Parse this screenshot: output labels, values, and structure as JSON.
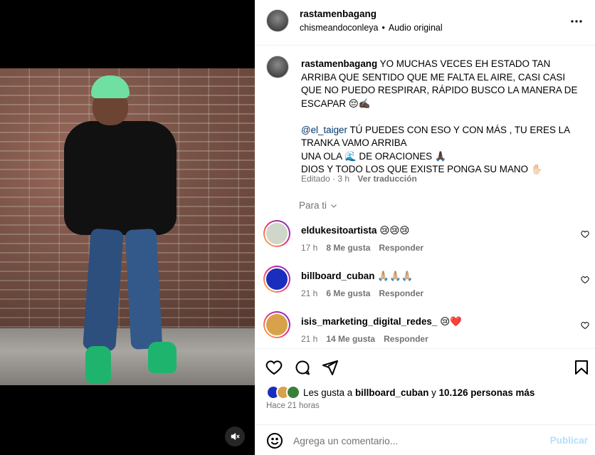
{
  "post": {
    "username": "rastamenbagang",
    "audio_user": "chismeandoconleya",
    "audio_sep": "•",
    "audio_label": "Audio original"
  },
  "caption": {
    "username": "rastamenbagang",
    "line1": "YO MUCHAS VECES EH ESTADO TAN ARRIBA QUE SENTIDO QUE ME FALTA EL AIRE, CASI CASI QUE NO PUEDO RESPIRAR, RÁPIDO BUSCO LA MANERA DE ESCAPAR 😔✍🏿",
    "mention": "@el_taiger",
    "line2": "TÚ PUEDES CON ESO Y CON MÁS , TU ERES LA TRANKA VAMO ARRIBA",
    "line3": "UNA OLA 🌊 DE ORACIONES 🙏🏿",
    "line4": "DIOS Y TODO LOS QUE EXISTE PONGA SU MANO ✋🏻",
    "edited": "Editado",
    "dot": "·",
    "time": "3 h",
    "translate": "Ver traducción"
  },
  "filter_label": "Para ti",
  "comments": [
    {
      "username": "eldukesitoartista",
      "text": "😢😢😢",
      "time": "17 h",
      "likes": "8 Me gusta",
      "reply": "Responder",
      "avatar_color": "#cfd8c8"
    },
    {
      "username": "billboard_cuban",
      "text": "🙏🏼🙏🏼🙏🏼",
      "time": "21 h",
      "likes": "6 Me gusta",
      "reply": "Responder",
      "avatar_color": "#1a2dbf"
    },
    {
      "username": "isis_marketing_digital_redes_",
      "text": "😢❤️",
      "time": "21 h",
      "likes": "14 Me gusta",
      "reply": "Responder",
      "avatar_color": "#d8a24a"
    }
  ],
  "likes": {
    "prefix": "Les gusta a",
    "user": "billboard_cuban",
    "middle": "y",
    "count": "10.126 personas más"
  },
  "posted_ago": "Hace 21 horas",
  "add_comment": {
    "placeholder": "Agrega un comentario...",
    "post_label": "Publicar"
  },
  "icons": {
    "more": "more-icon",
    "like": "heart-icon",
    "comment": "comment-icon",
    "share": "paper-plane-icon",
    "save": "bookmark-icon",
    "emoji": "emoji-icon",
    "mute": "speaker-muted-icon",
    "chevron": "chevron-down-icon"
  }
}
